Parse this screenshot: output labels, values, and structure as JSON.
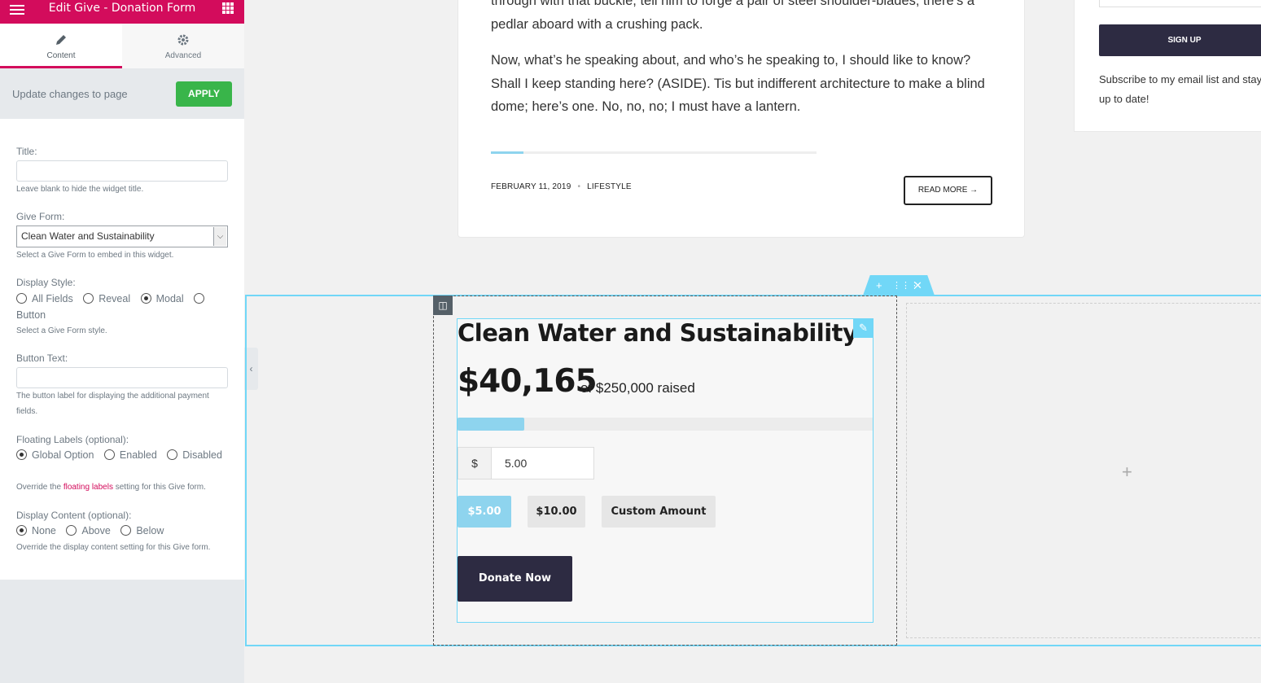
{
  "panel": {
    "header_title": "Edit Give - Donation Form",
    "tabs": [
      {
        "label": "Content",
        "icon": "pencil-icon"
      },
      {
        "label": "Advanced",
        "icon": "gear-icon"
      }
    ],
    "apply_message": "Update changes to page",
    "apply_label": "APPLY",
    "controls": {
      "title_label": "Title:",
      "title_value": "",
      "title_desc": "Leave blank to hide the widget title.",
      "form_label": "Give Form:",
      "form_value": "Clean Water and Sustainability",
      "form_desc": "Select a Give Form to embed in this widget.",
      "display_label": "Display Style:",
      "display_options": [
        "All Fields",
        "Reveal",
        "Modal",
        "Button"
      ],
      "display_selected": "Modal",
      "display_desc": "Select a Give Form style.",
      "button_text_label": "Button Text:",
      "button_text_value": "",
      "button_text_desc": "The button label for displaying the additional payment fields.",
      "floating_label": "Floating Labels (optional):",
      "floating_options": [
        "Global Option",
        "Enabled",
        "Disabled"
      ],
      "floating_selected": "Global Option",
      "floating_desc_pre": "Override the ",
      "floating_desc_link": "floating labels",
      "floating_desc_post": " setting for this Give form.",
      "content_label": "Display Content (optional):",
      "content_options": [
        "None",
        "Above",
        "Below"
      ],
      "content_selected": "None",
      "content_desc": "Override the display content setting for this Give form."
    }
  },
  "post": {
    "paragraph1": "through with that buckle, tell him to forge a pair of steel shoulder-blades; there’s a pedlar aboard with a crushing pack.",
    "paragraph2": "Now, what’s he speaking about, and who’s he speaking to, I should like to know? Shall I keep standing here? (ASIDE). Tis but indifferent architecture to make a blind dome; here’s one. No, no, no; I must have a lantern.",
    "date": "FEBRUARY 11, 2019",
    "category": "LIFESTYLE",
    "read_more": "READ MORE →"
  },
  "sidebar": {
    "signup_label": "SIGN UP",
    "subscribe_text": "Subscribe to my email list and stay up to date!"
  },
  "give_form": {
    "title": "Clean Water and Sustainability",
    "raised": "$40,165",
    "goal_text": "of $250,000 raised",
    "progress_fraction": 0.16066,
    "currency": "$",
    "amount": "5.00",
    "levels": [
      "$5.00",
      "$10.00",
      "Custom Amount"
    ],
    "selected_level": "$5.00",
    "donate_label": "Donate Now"
  },
  "colors": {
    "brand": "#d30c5c",
    "apply": "#39b54a",
    "accent": "#71d7f7",
    "progress": "#8ed4ee",
    "dark": "#2d2b42"
  }
}
